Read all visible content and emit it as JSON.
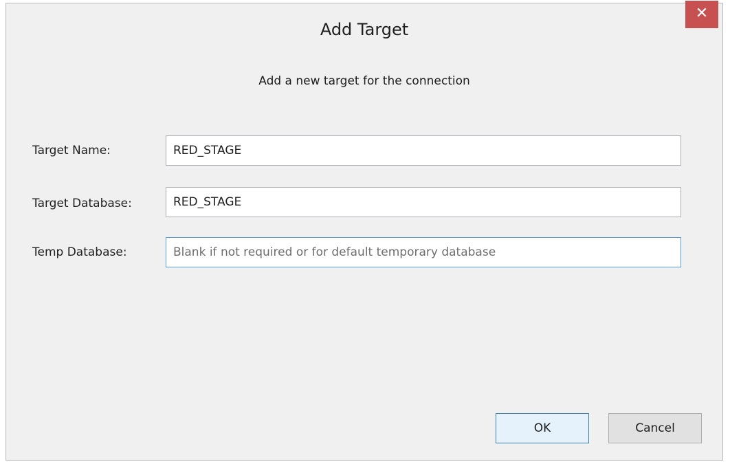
{
  "window": {
    "title": "Add Target",
    "close_label": "✕"
  },
  "dialog": {
    "subtitle": "Add a new target for the connection",
    "fields": [
      {
        "label": "Target Name:",
        "value": "RED_STAGE",
        "placeholder": ""
      },
      {
        "label": "Target Database:",
        "value": "RED_STAGE",
        "placeholder": ""
      },
      {
        "label": "Temp Database:",
        "value": "",
        "placeholder": "Blank if not required or for default temporary database"
      }
    ],
    "buttons": {
      "ok_label": "OK",
      "cancel_label": "Cancel"
    }
  },
  "colors": {
    "close_button": "#c75050",
    "focus_border": "#569de5",
    "ok_button_border": "#3c7fb1"
  }
}
